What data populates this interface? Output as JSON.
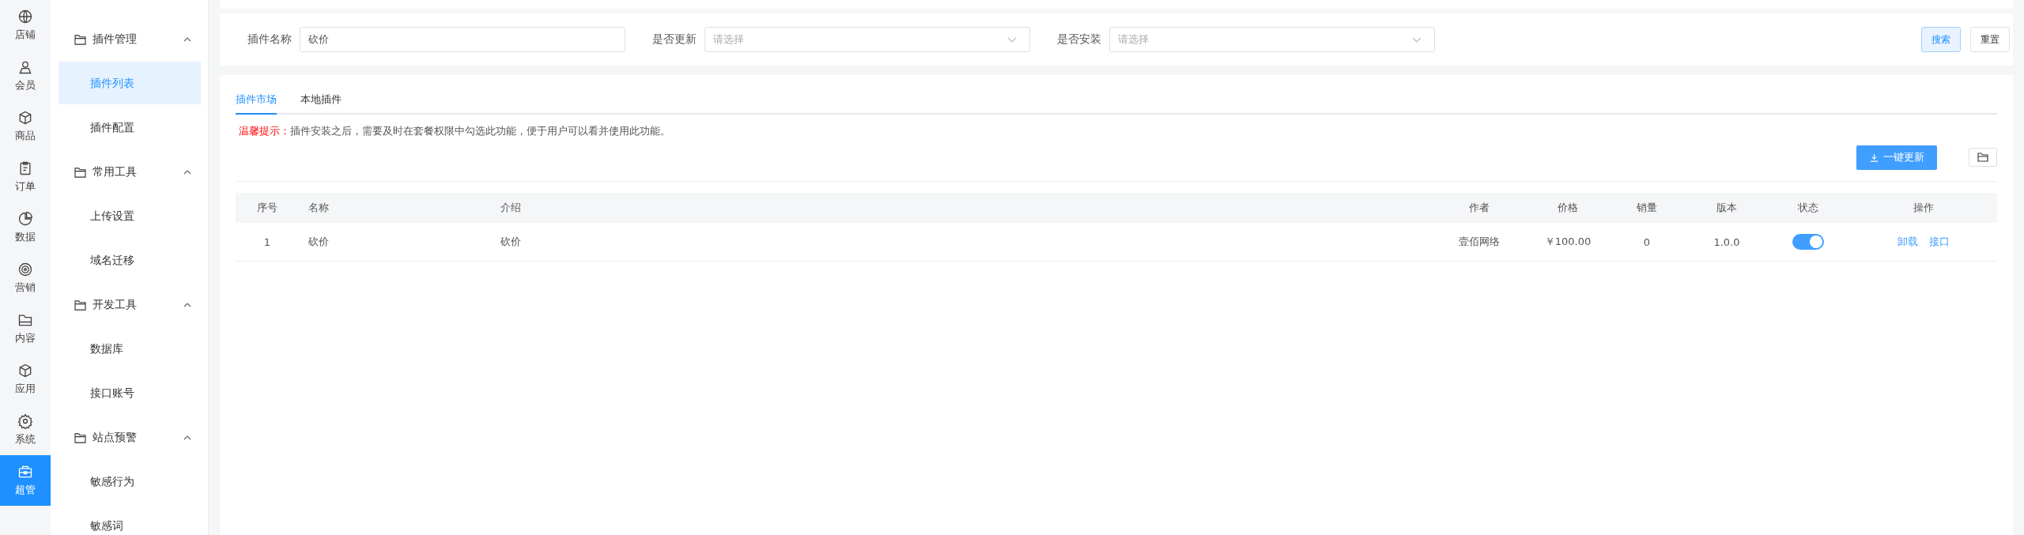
{
  "rail": [
    {
      "label": "店铺",
      "selected": false
    },
    {
      "label": "会员",
      "selected": false
    },
    {
      "label": "商品",
      "selected": false
    },
    {
      "label": "订单",
      "selected": false
    },
    {
      "label": "数据",
      "selected": false
    },
    {
      "label": "营销",
      "selected": false
    },
    {
      "label": "内容",
      "selected": false
    },
    {
      "label": "应用",
      "selected": false
    },
    {
      "label": "系统",
      "selected": false
    },
    {
      "label": "超管",
      "selected": true
    }
  ],
  "submenu": [
    {
      "label": "插件管理",
      "expanded": true,
      "children": [
        {
          "label": "插件列表",
          "selected": true
        },
        {
          "label": "插件配置",
          "selected": false
        }
      ]
    },
    {
      "label": "常用工具",
      "expanded": true,
      "children": [
        {
          "label": "上传设置",
          "selected": false
        },
        {
          "label": "域名迁移",
          "selected": false
        }
      ]
    },
    {
      "label": "开发工具",
      "expanded": true,
      "children": [
        {
          "label": "数据库",
          "selected": false
        },
        {
          "label": "接口账号",
          "selected": false
        }
      ]
    },
    {
      "label": "站点预警",
      "expanded": true,
      "children": [
        {
          "label": "敏感行为",
          "selected": false
        },
        {
          "label": "敏感词",
          "selected": false
        }
      ]
    }
  ],
  "filters": [
    {
      "kind": "input",
      "label": "插件名称",
      "value": "砍价"
    },
    {
      "kind": "select",
      "label": "是否更新",
      "placeholder": "请选择"
    },
    {
      "kind": "select",
      "label": "是否安装",
      "placeholder": "请选择"
    }
  ],
  "filter_buttons": [
    {
      "label": "搜索",
      "kind": "primary"
    },
    {
      "label": "重置",
      "kind": "default"
    }
  ],
  "tabs": [
    {
      "label": "插件市场",
      "selected": true
    },
    {
      "label": "本地插件",
      "selected": false
    }
  ],
  "notice": {
    "title": "温馨提示：",
    "text": "插件安装之后，需要及时在套餐权限中勾选此功能，便于用户可以看并使用此功能。"
  },
  "update_button": "一键更新",
  "table": {
    "columns": [
      "序号",
      "名称",
      "介绍",
      "作者",
      "价格",
      "销量",
      "版本",
      "状态",
      "操作"
    ],
    "rows": [
      {
        "cells": [
          "1",
          "砍价",
          "砍价",
          "壹佰网络",
          "￥100.00",
          "0",
          "1.0.0"
        ],
        "on": true,
        "actions": [
          "卸载",
          "接口"
        ]
      }
    ]
  }
}
